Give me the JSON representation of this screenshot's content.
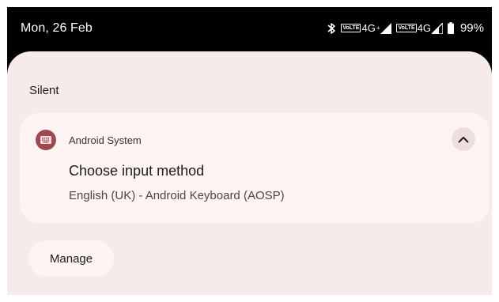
{
  "status_bar": {
    "date": "Mon, 26 Feb",
    "volte_label": "VoLTE",
    "sim1_network": "4G",
    "sim1_network_sup": "+",
    "sim2_network": "4G",
    "battery": "99%",
    "icons": [
      "bluetooth-icon",
      "signal-icon",
      "battery-icon"
    ]
  },
  "shade": {
    "section_label": "Silent",
    "background": "#f6ebea"
  },
  "notification": {
    "app_name": "Android System",
    "title": "Choose input method",
    "text": "English (UK) - Android Keyboard (AOSP)",
    "app_icon": "keyboard-icon",
    "app_icon_color": "#9c4a52",
    "expand_icon": "chevron-up-icon"
  },
  "actions": {
    "manage_label": "Manage"
  }
}
